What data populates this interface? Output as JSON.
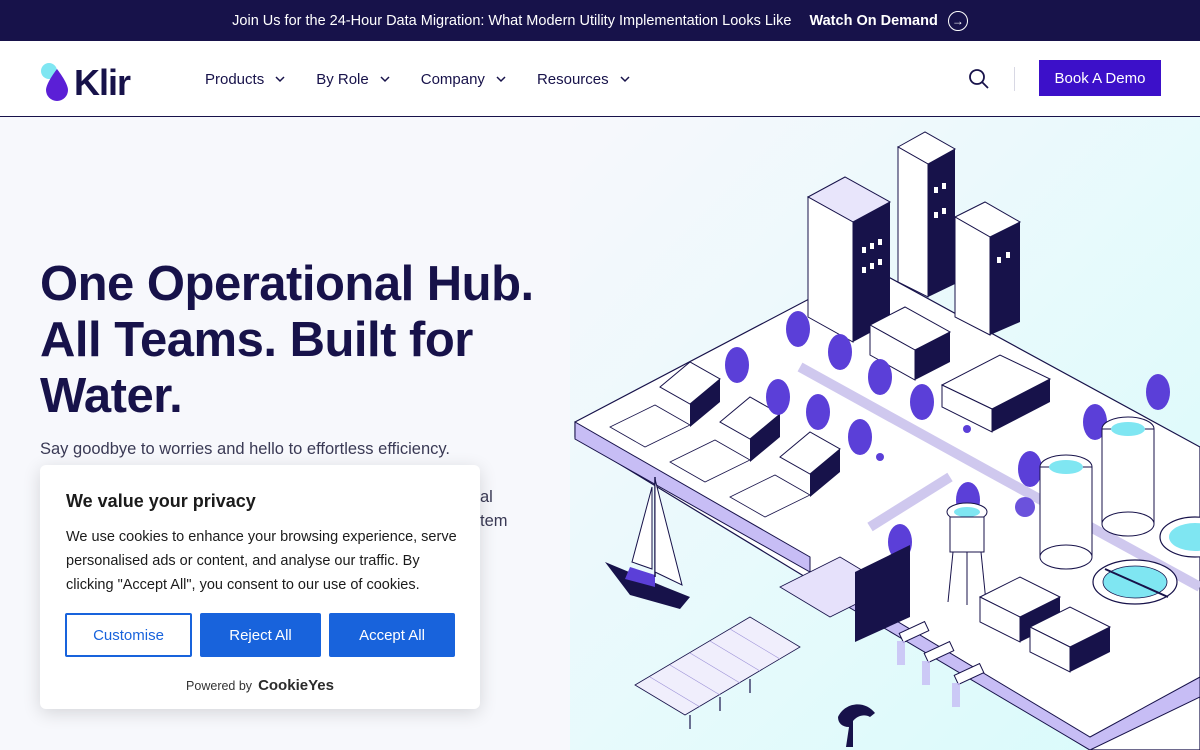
{
  "announcement": {
    "message": "Join Us for the 24-Hour Data Migration: What Modern Utility Implementation Looks Like",
    "cta_label": "Watch On Demand"
  },
  "nav": {
    "logo_text": "Klir",
    "items": [
      {
        "label": "Products"
      },
      {
        "label": "By Role"
      },
      {
        "label": "Company"
      },
      {
        "label": "Resources"
      }
    ],
    "demo_label": "Book A Demo"
  },
  "hero": {
    "title_bold": "One Operational Hub.",
    "title_rest": " All Teams. Built for Water.",
    "subtitle": "Say goodbye to worries and hello to effortless efficiency.",
    "hidden_tail_1": "al",
    "hidden_tail_2": "tem"
  },
  "cookie": {
    "title": "We value your privacy",
    "body": "We use cookies to enhance your browsing experience, serve personalised ads or content, and analyse our traffic. By clicking \"Accept All\", you consent to our use of cookies.",
    "customise_label": "Customise",
    "reject_label": "Reject All",
    "accept_label": "Accept All",
    "powered_by": "Powered by",
    "brand": "CookieYes"
  },
  "colors": {
    "navy": "#17124a",
    "accent": "#3c10c9",
    "cookie_blue": "#1863dc",
    "illustration_purple": "#5b3fd8",
    "water_cyan": "#7fe6f2"
  }
}
